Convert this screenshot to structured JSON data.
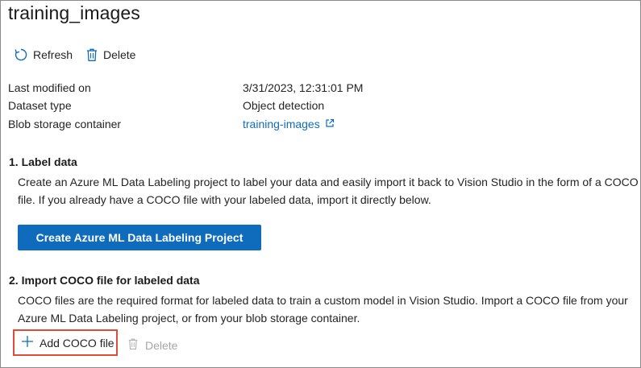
{
  "page": {
    "title": "training_images"
  },
  "toolbar": {
    "refresh_label": "Refresh",
    "delete_label": "Delete"
  },
  "details": {
    "rows": [
      {
        "label": "Last modified on",
        "value": "3/31/2023, 12:31:01 PM"
      },
      {
        "label": "Dataset type",
        "value": "Object detection"
      },
      {
        "label": "Blob storage container",
        "value": "training-images"
      }
    ]
  },
  "section1": {
    "heading": "1. Label data",
    "description": "Create an Azure ML Data Labeling project to label your data and easily import it back to Vision Studio in the form of a COCO file. If you already have a COCO file with your labeled data, import it directly below.",
    "button_label": "Create Azure ML Data Labeling Project"
  },
  "section2": {
    "heading": "2. Import COCO file for labeled data",
    "description": "COCO files are the required format for labeled data to train a custom model in Vision Studio. Import a COCO file from your Azure ML Data Labeling project, or from your blob storage container.",
    "add_label": "Add COCO file",
    "delete_label": "Delete"
  },
  "colors": {
    "accent": "#0f6cbd",
    "highlight_border": "#e04b3a",
    "disabled_text": "#a6a6a6"
  },
  "icons": {
    "refresh": "refresh-icon",
    "delete": "trash-icon",
    "external": "external-link-icon",
    "add": "plus-icon"
  }
}
